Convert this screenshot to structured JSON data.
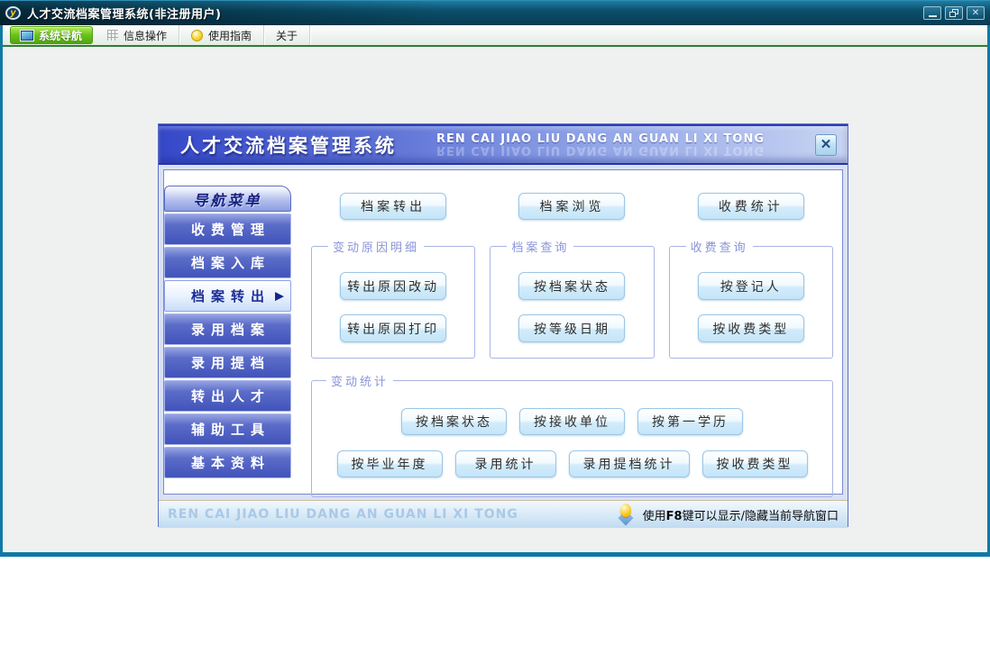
{
  "window": {
    "title": "人才交流档案管理系统(非注册用户)",
    "icon_letter": "y",
    "controls": [
      {
        "name": "minimize"
      },
      {
        "name": "restore"
      },
      {
        "name": "close"
      }
    ]
  },
  "toolbar": {
    "items": [
      {
        "label": "系统导航",
        "icon": "nav-square-icon",
        "active": true
      },
      {
        "label": "信息操作",
        "icon": "grid-icon",
        "active": false
      },
      {
        "label": "使用指南",
        "icon": "guide-clock-icon",
        "active": false
      },
      {
        "label": "关于",
        "icon": null,
        "active": false
      }
    ]
  },
  "dialog": {
    "title": "人才交流档案管理系统",
    "subtitle": "REN CAI JIAO LIU DANG AN GUAN LI XI TONG",
    "sidebar": {
      "header": "导航菜单",
      "items": [
        {
          "label": "收费管理",
          "selected": false
        },
        {
          "label": "档案入库",
          "selected": false
        },
        {
          "label": "档案转出",
          "selected": true
        },
        {
          "label": "录用档案",
          "selected": false
        },
        {
          "label": "录用提档",
          "selected": false
        },
        {
          "label": "转出人才",
          "selected": false
        },
        {
          "label": "辅助工具",
          "selected": false
        },
        {
          "label": "基本资料",
          "selected": false
        }
      ]
    },
    "quick_buttons": [
      "档案转出",
      "档案浏览",
      "收费统计"
    ],
    "groups": [
      {
        "title": "变动原因明细",
        "buttons": [
          "转出原因改动",
          "转出原因打印"
        ]
      },
      {
        "title": "档案查询",
        "buttons": [
          "按档案状态",
          "按等级日期"
        ]
      },
      {
        "title": "收费查询",
        "buttons": [
          "按登记人",
          "按收费类型"
        ]
      }
    ],
    "stats_group": {
      "title": "变动统计",
      "rows": [
        [
          "按档案状态",
          "按接收单位",
          "按第一学历"
        ],
        [
          "按毕业年度",
          "录用统计",
          "录用提档统计",
          "按收费类型"
        ]
      ]
    },
    "statusbar": {
      "left": "REN CAI JIAO LIU DANG AN GUAN LI XI TONG",
      "hint_pre": "使用",
      "hint_key": "F8",
      "hint_post": "键可以显示/隐藏当前导航窗口"
    }
  },
  "icons": {
    "dialog_close": "✕",
    "selected_arrow": "▶",
    "lightbulb": "lightbulb-icon"
  },
  "colors": {
    "titlebar_teal": "#0b4f6b",
    "frame_teal": "#0f79a5",
    "active_green": "#5cb414",
    "toolbar_green_line": "#2f7d35",
    "header_blue_left": "#3548c9",
    "header_blue_right": "#c7d4f2",
    "sidebar_blue": "#4153ba",
    "button_blue": "#c4e5f8",
    "group_label_purple": "#8a94d8",
    "status_bar_blue": "#c0dcf2"
  }
}
